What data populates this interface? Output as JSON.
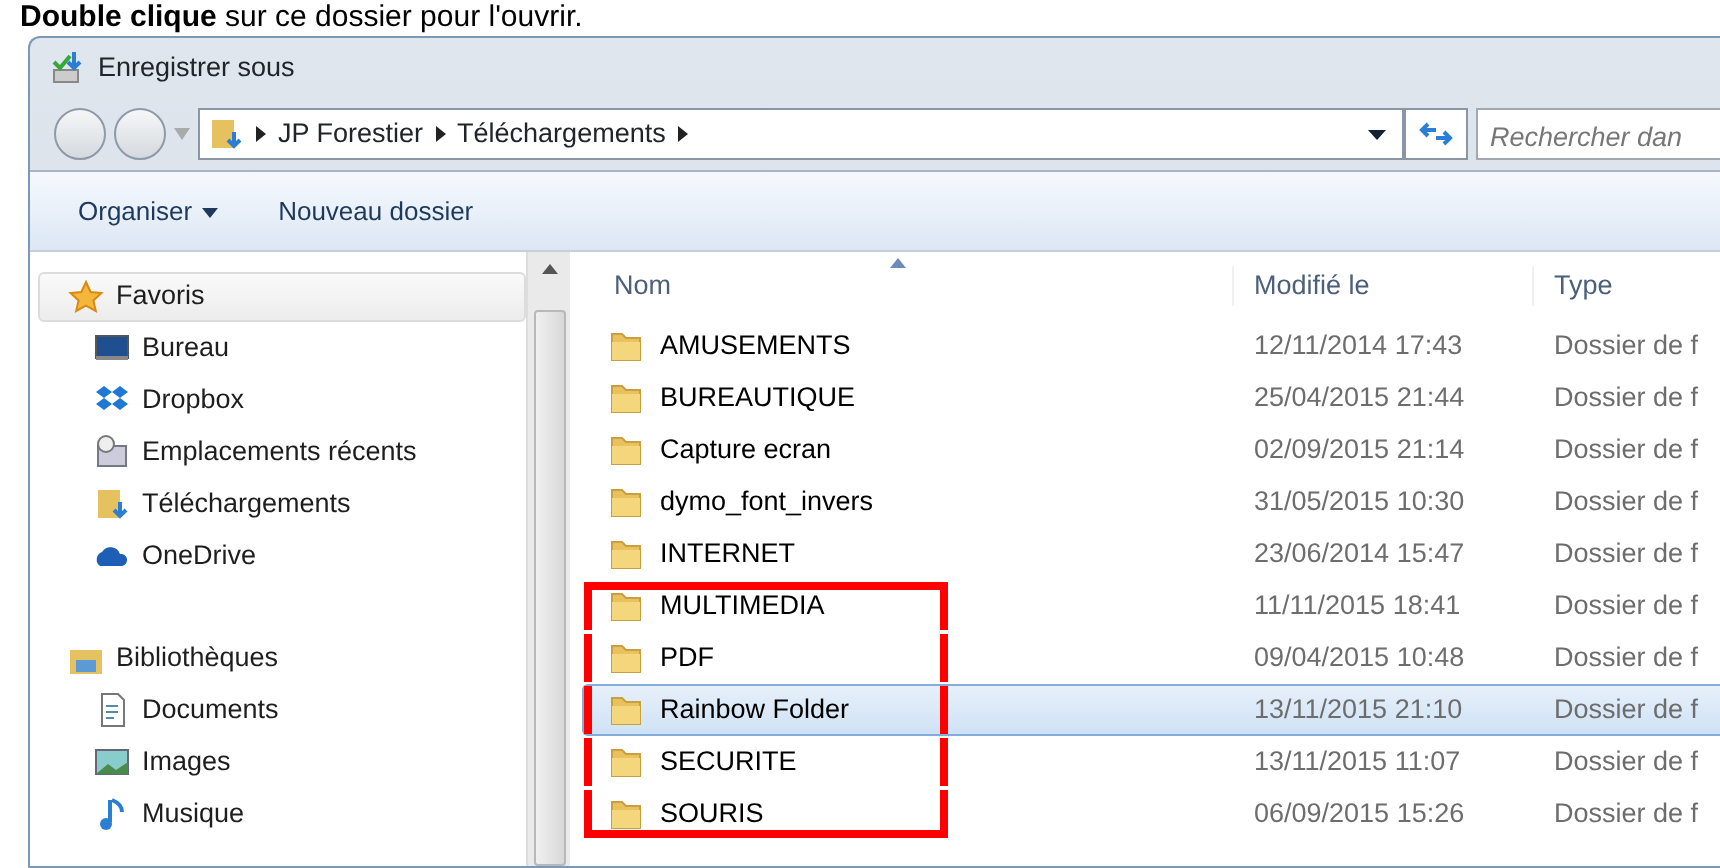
{
  "caption": "**Double clique** sur ce dossier pour l'ouvrir.",
  "window": {
    "title": "Enregistrer sous"
  },
  "address_bar": {
    "path": [
      "JP Forestier",
      "Téléchargements"
    ]
  },
  "search": {
    "placeholder": "Rechercher dan"
  },
  "toolbar": [
    {
      "label": "Organiser",
      "dropdown": true
    },
    {
      "label": "Nouveau dossier",
      "dropdown": false
    }
  ],
  "sidebar": {
    "groups": [
      {
        "label": "Favoris",
        "selected": true,
        "items": [
          {
            "label": "Bureau"
          },
          {
            "label": "Dropbox"
          },
          {
            "label": "Emplacements récents"
          },
          {
            "label": "Téléchargements"
          },
          {
            "label": "OneDrive"
          }
        ]
      },
      {
        "label": "Bibliothèques",
        "selected": false,
        "items": [
          {
            "label": "Documents"
          },
          {
            "label": "Images"
          },
          {
            "label": "Musique"
          }
        ]
      }
    ]
  },
  "table": {
    "columns": [
      "Nom",
      "Modifié le",
      "Type"
    ],
    "rows": [
      {
        "name": "AMUSEMENTS",
        "modified": "12/11/2014 17:43",
        "type": "Dossier de f",
        "selected": false,
        "marked": false
      },
      {
        "name": "BUREAUTIQUE",
        "modified": "25/04/2015 21:44",
        "type": "Dossier de f",
        "selected": false,
        "marked": false
      },
      {
        "name": "Capture ecran",
        "modified": "02/09/2015 21:14",
        "type": "Dossier de f",
        "selected": false,
        "marked": false
      },
      {
        "name": "dymo_font_invers",
        "modified": "31/05/2015 10:30",
        "type": "Dossier de f",
        "selected": false,
        "marked": false
      },
      {
        "name": "INTERNET",
        "modified": "23/06/2014 15:47",
        "type": "Dossier de f",
        "selected": false,
        "marked": false
      },
      {
        "name": "MULTIMEDIA",
        "modified": "11/11/2015 18:41",
        "type": "Dossier de f",
        "selected": false,
        "marked": true
      },
      {
        "name": "PDF",
        "modified": "09/04/2015 10:48",
        "type": "Dossier de f",
        "selected": false,
        "marked": true
      },
      {
        "name": "Rainbow Folder",
        "modified": "13/11/2015 21:10",
        "type": "Dossier de f",
        "selected": true,
        "marked": true
      },
      {
        "name": "SECURITE",
        "modified": "13/11/2015 11:07",
        "type": "Dossier de f",
        "selected": false,
        "marked": true
      },
      {
        "name": "SOURIS",
        "modified": "06/09/2015 15:26",
        "type": "Dossier de f",
        "selected": false,
        "marked": true
      }
    ]
  }
}
